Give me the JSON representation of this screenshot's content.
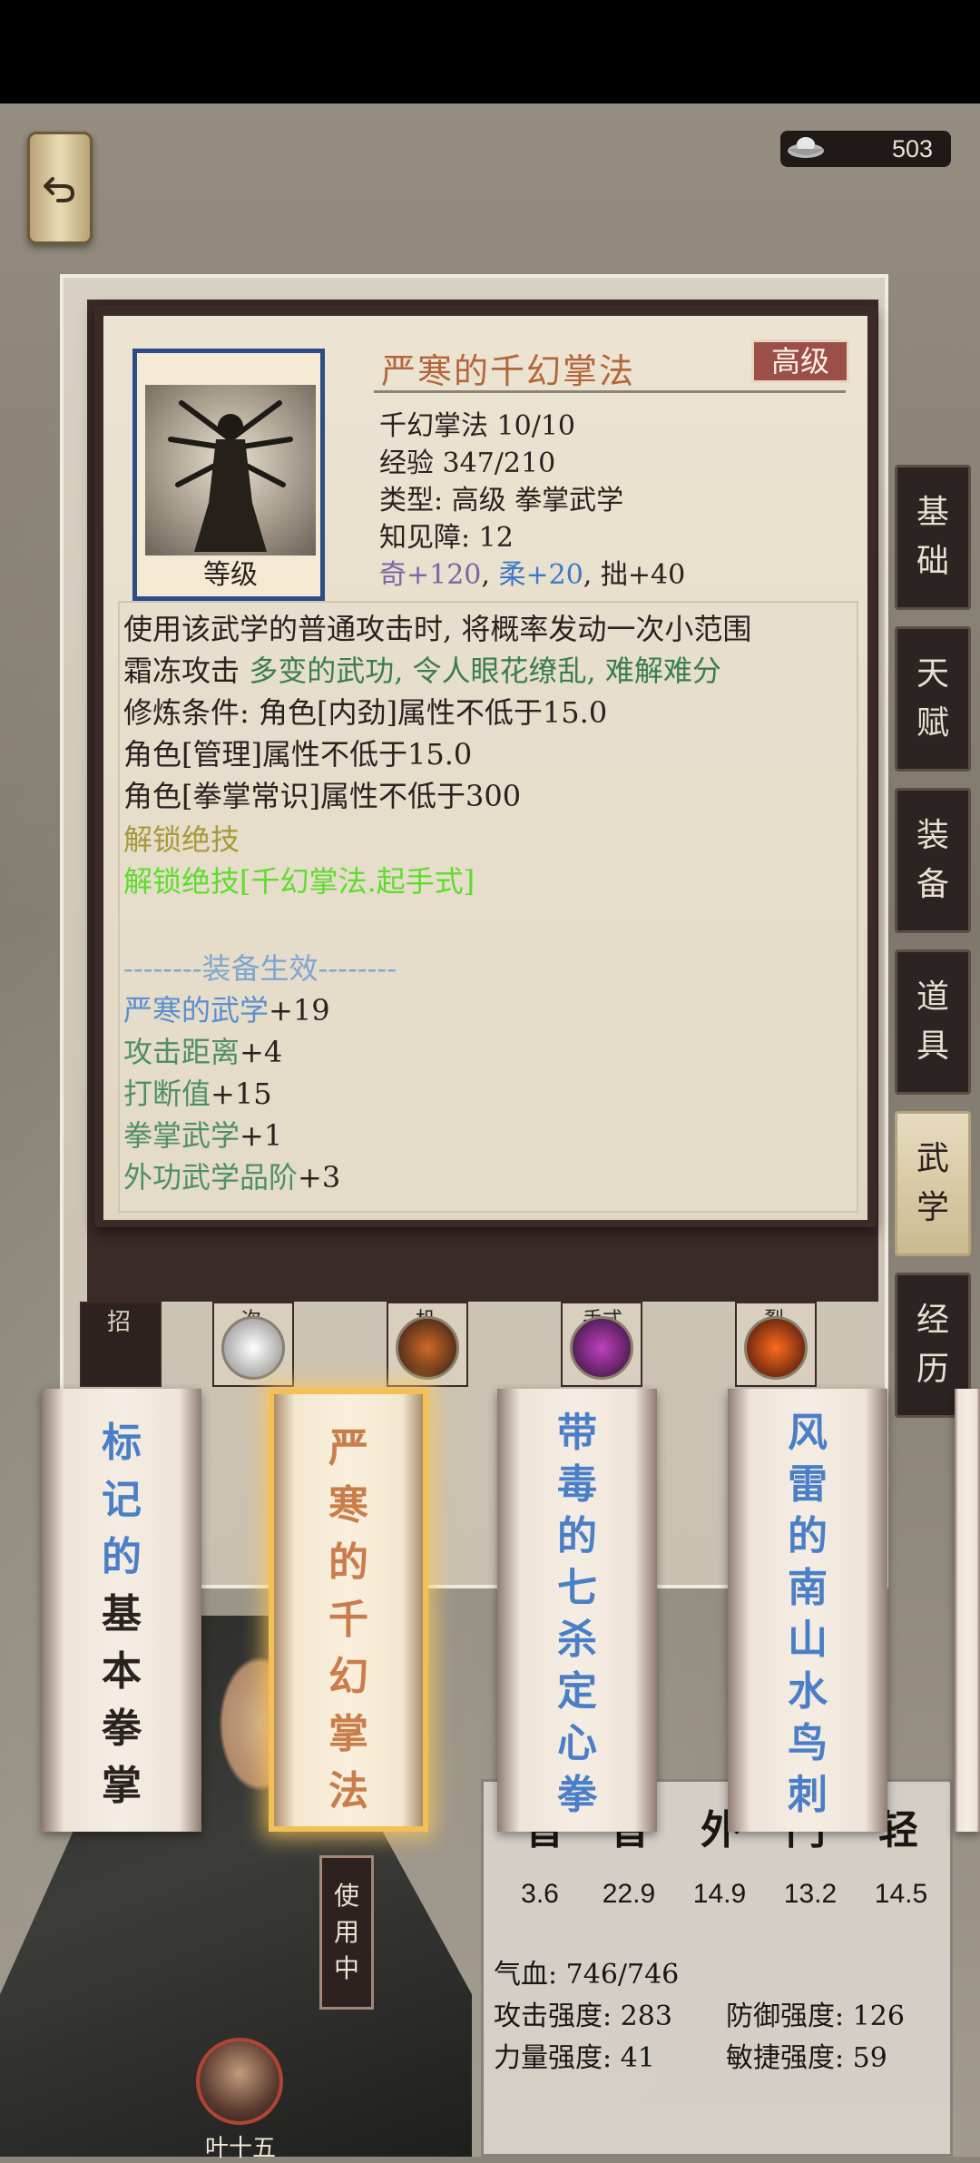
{
  "currency": {
    "amount": "503",
    "icon": "silver-ingot-icon"
  },
  "back_button": {
    "icon": "back-arrow-icon"
  },
  "side_tabs": [
    {
      "label_top": "基",
      "label_bottom": "础"
    },
    {
      "label_top": "天",
      "label_bottom": "赋"
    },
    {
      "label_top": "装",
      "label_bottom": "备"
    },
    {
      "label_top": "道",
      "label_bottom": "具"
    },
    {
      "label_top": "武",
      "label_bottom": "学"
    },
    {
      "label_top": "经",
      "label_bottom": "历"
    }
  ],
  "detail": {
    "title": "严寒的千幻掌法",
    "grade": "高级",
    "portrait_label": "等级",
    "skill_level": "千幻掌法 10/10",
    "experience": "经验 347/210",
    "type": "类型: 高级 拳掌武学",
    "insight": "知见障: 12",
    "attr_qi": "奇+120",
    "attr_rou": "柔+20",
    "attr_zhuo": "拙+40",
    "desc_line1": "使用该武学的普通攻击时, 将概率发动一次小范围",
    "desc_line2a": "霜冻攻击",
    "desc_line2b": "多变的武功, 令人眼花缭乱, 难解难分",
    "req_line1": "修炼条件: 角色[内劲]属性不低于15.0",
    "req_line2": "角色[管理]属性不低于15.0",
    "req_line3": "角色[拳掌常识]属性不低于300",
    "unlock_title": "解锁绝技",
    "unlock_skill": "解锁绝技[千幻掌法.起手式]",
    "equip_header": "--------装备生效--------",
    "effects": [
      {
        "name": "严寒的武学",
        "value": "+19"
      },
      {
        "name": "攻击距离",
        "value": "+4"
      },
      {
        "name": "打断值",
        "value": "+15"
      },
      {
        "name": "拳掌武学",
        "value": "+1"
      },
      {
        "name": "外功武学品阶",
        "value": "+3"
      }
    ]
  },
  "strip_labels": [
    "招",
    "次",
    "机",
    "手式",
    "裂"
  ],
  "scrolls": [
    {
      "name": "标记的基本拳掌",
      "chars": [
        "标",
        "记",
        "的",
        "基",
        "本",
        "拳",
        "掌"
      ],
      "selected": false
    },
    {
      "name": "严寒的千幻掌法",
      "chars": [
        "严",
        "寒",
        "的",
        "千",
        "幻",
        "掌",
        "法"
      ],
      "selected": true
    },
    {
      "name": "带毒的七杀定心拳",
      "chars": [
        "带",
        "毒",
        "的",
        "七",
        "杀",
        "定",
        "心",
        "拳"
      ],
      "selected": false
    },
    {
      "name": "风雷的南山水鸟刺",
      "chars": [
        "风",
        "雷",
        "的",
        "南",
        "山",
        "水",
        "鸟",
        "刺"
      ],
      "selected": false
    }
  ],
  "in_use": {
    "chars": [
      "使",
      "用",
      "中"
    ]
  },
  "character": {
    "name": "叶十五"
  },
  "stats": {
    "headers": [
      "音",
      "音",
      "外",
      "门",
      "轻"
    ],
    "values": [
      "3.6",
      "22.9",
      "14.9",
      "13.2",
      "14.5"
    ],
    "hp": "气血: 746/746",
    "attack": "攻击强度: 283",
    "defense": "防御强度: 126",
    "strength": "力量强度: 41",
    "agility": "敏捷强度: 59"
  }
}
